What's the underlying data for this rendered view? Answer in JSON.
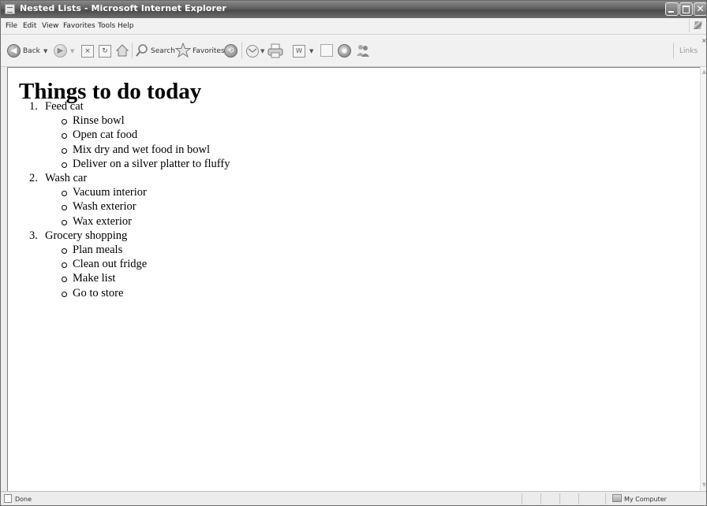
{
  "window": {
    "title": "Nested Lists - Microsoft Internet Explorer"
  },
  "menu": {
    "items": [
      "File",
      "Edit",
      "View",
      "Favorites",
      "Tools",
      "Help"
    ]
  },
  "toolbar": {
    "back_label": "Back",
    "search_label": "Search",
    "favorites_label": "Favorites",
    "links_label": "Links",
    "close_mark": "×"
  },
  "page": {
    "heading": "Things to do today",
    "tasks": [
      {
        "number": "1.",
        "label": "Feed cat",
        "subtasks": [
          "Rinse bowl",
          "Open cat food",
          "Mix dry and wet food in bowl",
          "Deliver on a silver platter to fluffy"
        ]
      },
      {
        "number": "2.",
        "label": "Wash car",
        "subtasks": [
          "Vacuum interior",
          "Wash exterior",
          "Wax exterior"
        ]
      },
      {
        "number": "3.",
        "label": "Grocery shopping",
        "subtasks": [
          "Plan meals",
          "Clean out fridge",
          "Make list",
          "Go to store"
        ]
      }
    ]
  },
  "status": {
    "text": "Done",
    "zone": "My Computer"
  },
  "icons": {
    "back": "back-arrow-icon",
    "forward": "forward-arrow-icon",
    "stop": "stop-icon",
    "refresh": "refresh-icon",
    "home": "home-icon",
    "search": "search-icon",
    "favorites": "favorites-star-icon",
    "history": "history-icon",
    "mail": "mail-icon",
    "print": "print-icon",
    "edit": "edit-icon",
    "discuss": "discuss-icon",
    "research": "research-icon",
    "messenger": "messenger-icon"
  }
}
